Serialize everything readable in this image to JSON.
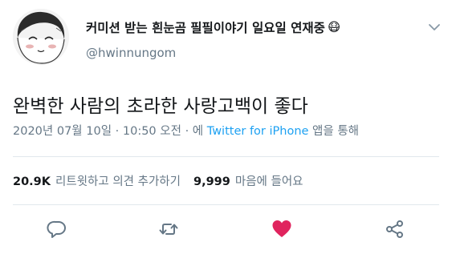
{
  "author": {
    "display_name": "커미션 받는 흰눈곰 필필이야기 일요일 연재중",
    "emoji": "😷",
    "handle": "@hwinnungom"
  },
  "tweet": {
    "text": "완벽한 사람의 초라한 사랑고백이 좋다",
    "date": "2020년 07월 10일",
    "separator": "·",
    "time": "10:50 오전",
    "source_prefix": "· 에",
    "source": "Twitter for iPhone",
    "source_suffix": "앱을 통해"
  },
  "stats": {
    "retweets_count": "20.9K",
    "retweets_label": "리트윗하고 의견 추가하기",
    "likes_count": "9,999",
    "likes_label": "마음에 들어요"
  },
  "actions": {
    "like_color": "#e0245e",
    "icon_color": "#657786",
    "icons": [
      "reply-icon",
      "retweet-icon",
      "like-icon",
      "share-icon"
    ]
  }
}
